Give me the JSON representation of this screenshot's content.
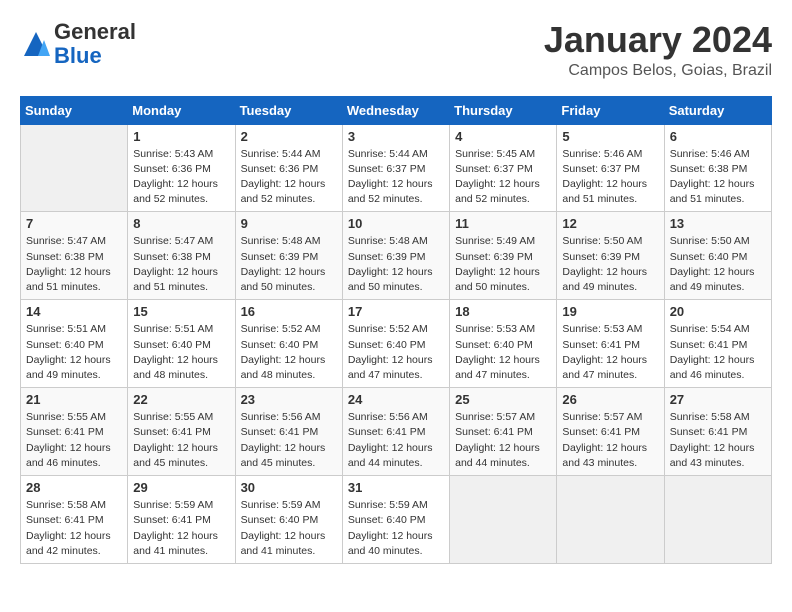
{
  "header": {
    "logo_line1": "General",
    "logo_line2": "Blue",
    "title": "January 2024",
    "subtitle": "Campos Belos, Goias, Brazil"
  },
  "days_of_week": [
    "Sunday",
    "Monday",
    "Tuesday",
    "Wednesday",
    "Thursday",
    "Friday",
    "Saturday"
  ],
  "weeks": [
    [
      {
        "day": "",
        "info": ""
      },
      {
        "day": "1",
        "info": "Sunrise: 5:43 AM\nSunset: 6:36 PM\nDaylight: 12 hours\nand 52 minutes."
      },
      {
        "day": "2",
        "info": "Sunrise: 5:44 AM\nSunset: 6:36 PM\nDaylight: 12 hours\nand 52 minutes."
      },
      {
        "day": "3",
        "info": "Sunrise: 5:44 AM\nSunset: 6:37 PM\nDaylight: 12 hours\nand 52 minutes."
      },
      {
        "day": "4",
        "info": "Sunrise: 5:45 AM\nSunset: 6:37 PM\nDaylight: 12 hours\nand 52 minutes."
      },
      {
        "day": "5",
        "info": "Sunrise: 5:46 AM\nSunset: 6:37 PM\nDaylight: 12 hours\nand 51 minutes."
      },
      {
        "day": "6",
        "info": "Sunrise: 5:46 AM\nSunset: 6:38 PM\nDaylight: 12 hours\nand 51 minutes."
      }
    ],
    [
      {
        "day": "7",
        "info": "Sunrise: 5:47 AM\nSunset: 6:38 PM\nDaylight: 12 hours\nand 51 minutes."
      },
      {
        "day": "8",
        "info": "Sunrise: 5:47 AM\nSunset: 6:38 PM\nDaylight: 12 hours\nand 51 minutes."
      },
      {
        "day": "9",
        "info": "Sunrise: 5:48 AM\nSunset: 6:39 PM\nDaylight: 12 hours\nand 50 minutes."
      },
      {
        "day": "10",
        "info": "Sunrise: 5:48 AM\nSunset: 6:39 PM\nDaylight: 12 hours\nand 50 minutes."
      },
      {
        "day": "11",
        "info": "Sunrise: 5:49 AM\nSunset: 6:39 PM\nDaylight: 12 hours\nand 50 minutes."
      },
      {
        "day": "12",
        "info": "Sunrise: 5:50 AM\nSunset: 6:39 PM\nDaylight: 12 hours\nand 49 minutes."
      },
      {
        "day": "13",
        "info": "Sunrise: 5:50 AM\nSunset: 6:40 PM\nDaylight: 12 hours\nand 49 minutes."
      }
    ],
    [
      {
        "day": "14",
        "info": "Sunrise: 5:51 AM\nSunset: 6:40 PM\nDaylight: 12 hours\nand 49 minutes."
      },
      {
        "day": "15",
        "info": "Sunrise: 5:51 AM\nSunset: 6:40 PM\nDaylight: 12 hours\nand 48 minutes."
      },
      {
        "day": "16",
        "info": "Sunrise: 5:52 AM\nSunset: 6:40 PM\nDaylight: 12 hours\nand 48 minutes."
      },
      {
        "day": "17",
        "info": "Sunrise: 5:52 AM\nSunset: 6:40 PM\nDaylight: 12 hours\nand 47 minutes."
      },
      {
        "day": "18",
        "info": "Sunrise: 5:53 AM\nSunset: 6:40 PM\nDaylight: 12 hours\nand 47 minutes."
      },
      {
        "day": "19",
        "info": "Sunrise: 5:53 AM\nSunset: 6:41 PM\nDaylight: 12 hours\nand 47 minutes."
      },
      {
        "day": "20",
        "info": "Sunrise: 5:54 AM\nSunset: 6:41 PM\nDaylight: 12 hours\nand 46 minutes."
      }
    ],
    [
      {
        "day": "21",
        "info": "Sunrise: 5:55 AM\nSunset: 6:41 PM\nDaylight: 12 hours\nand 46 minutes."
      },
      {
        "day": "22",
        "info": "Sunrise: 5:55 AM\nSunset: 6:41 PM\nDaylight: 12 hours\nand 45 minutes."
      },
      {
        "day": "23",
        "info": "Sunrise: 5:56 AM\nSunset: 6:41 PM\nDaylight: 12 hours\nand 45 minutes."
      },
      {
        "day": "24",
        "info": "Sunrise: 5:56 AM\nSunset: 6:41 PM\nDaylight: 12 hours\nand 44 minutes."
      },
      {
        "day": "25",
        "info": "Sunrise: 5:57 AM\nSunset: 6:41 PM\nDaylight: 12 hours\nand 44 minutes."
      },
      {
        "day": "26",
        "info": "Sunrise: 5:57 AM\nSunset: 6:41 PM\nDaylight: 12 hours\nand 43 minutes."
      },
      {
        "day": "27",
        "info": "Sunrise: 5:58 AM\nSunset: 6:41 PM\nDaylight: 12 hours\nand 43 minutes."
      }
    ],
    [
      {
        "day": "28",
        "info": "Sunrise: 5:58 AM\nSunset: 6:41 PM\nDaylight: 12 hours\nand 42 minutes."
      },
      {
        "day": "29",
        "info": "Sunrise: 5:59 AM\nSunset: 6:41 PM\nDaylight: 12 hours\nand 41 minutes."
      },
      {
        "day": "30",
        "info": "Sunrise: 5:59 AM\nSunset: 6:40 PM\nDaylight: 12 hours\nand 41 minutes."
      },
      {
        "day": "31",
        "info": "Sunrise: 5:59 AM\nSunset: 6:40 PM\nDaylight: 12 hours\nand 40 minutes."
      },
      {
        "day": "",
        "info": ""
      },
      {
        "day": "",
        "info": ""
      },
      {
        "day": "",
        "info": ""
      }
    ]
  ]
}
